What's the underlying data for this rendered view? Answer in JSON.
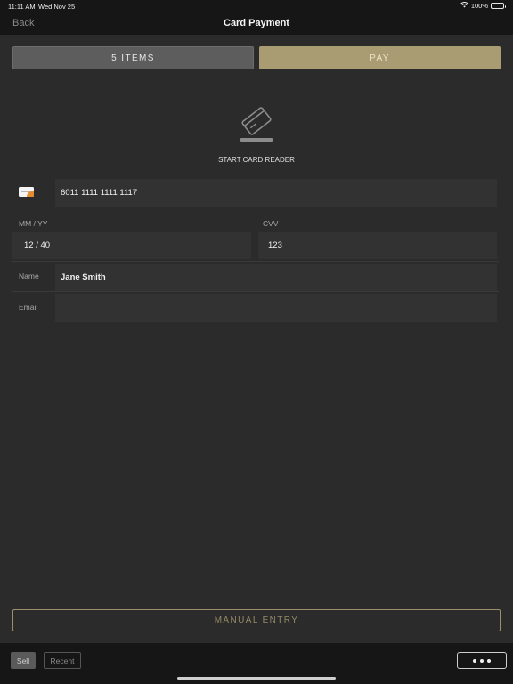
{
  "status": {
    "time": "11:11 AM",
    "date": "Wed Nov 25",
    "battery": "100%"
  },
  "nav": {
    "back": "Back",
    "title": "Card Payment"
  },
  "actions": {
    "items_label": "5 ITEMS",
    "pay_label": "PAY"
  },
  "reader": {
    "label": "START CARD READER"
  },
  "form": {
    "card_number": "6011 1111 1111 1117",
    "expiry_label": "MM / YY",
    "expiry_value": "12 / 40",
    "cvv_label": "CVV",
    "cvv_value": "123",
    "name_label": "Name",
    "name_value": "Jane Smith",
    "email_label": "Email",
    "email_value": ""
  },
  "manual_entry": "MANUAL ENTRY",
  "bottom": {
    "sell": "Sell",
    "recent": "Recent"
  },
  "icons": {
    "status": [
      "wifi-icon",
      "battery-icon"
    ],
    "reader": "card-reader-icon",
    "card": "card-brand-icon",
    "more": "more-icon"
  },
  "colors": {
    "accent": "#a99c72",
    "background": "#2b2b2b",
    "bar": "#161616"
  }
}
